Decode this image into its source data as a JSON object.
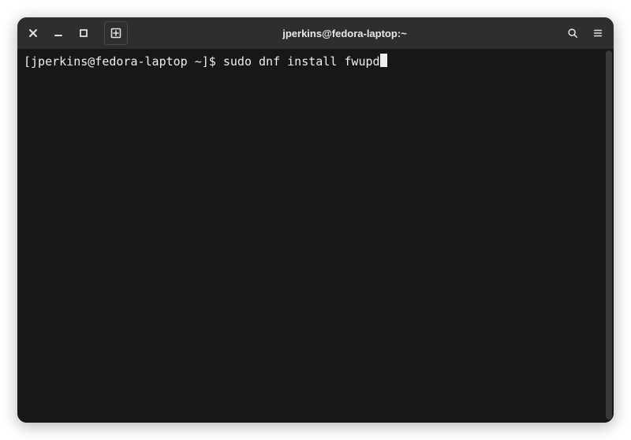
{
  "window": {
    "title": "jperkins@fedora-laptop:~"
  },
  "terminal": {
    "prompt": "[jperkins@fedora-laptop ~]$ ",
    "command": "sudo dnf install fwupd"
  },
  "icons": {
    "close": "close",
    "minimize": "minimize",
    "maximize": "maximize",
    "new_tab": "new-tab",
    "search": "search",
    "menu": "menu"
  }
}
